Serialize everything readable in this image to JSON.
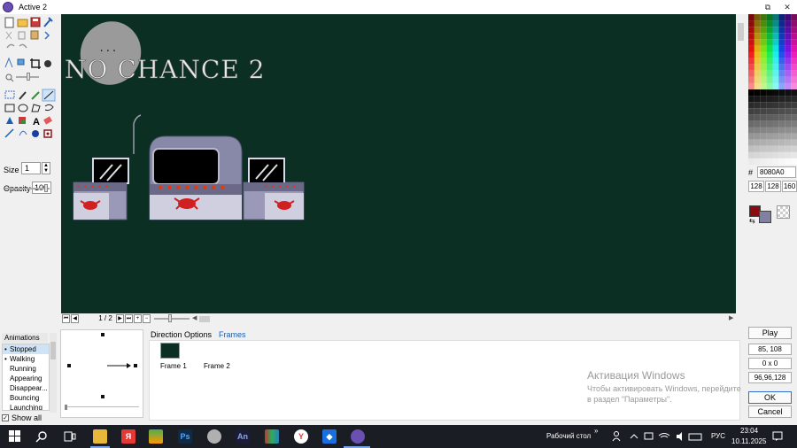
{
  "window": {
    "title": "Active 2",
    "buttons": [
      "⧉",
      "✕"
    ]
  },
  "toolbox": {
    "size_label": "Size",
    "size_value": "1",
    "opacity_label": "Opacity",
    "opacity_value": "100"
  },
  "canvas": {
    "background": "#0b2f22",
    "game_title": "NO CHANCE 2",
    "speech_dots": "..."
  },
  "framebar": {
    "counter": "1 / 2"
  },
  "color_panel": {
    "hash": "#",
    "hex": "8080A0",
    "r": "128",
    "g": "128",
    "b": "160",
    "fg_color": "#8a0a12",
    "bg_color": "#8080a0"
  },
  "animations": {
    "title": "Animations",
    "items": [
      "Stopped",
      "Walking",
      "Running",
      "Appearing",
      "Disappear...",
      "Bouncing",
      "Launching"
    ],
    "selected": "Stopped",
    "show_all_label": "Show all"
  },
  "tabs": {
    "direction": "Direction Options",
    "frames": "Frames"
  },
  "frames": [
    {
      "label": "Frame 1",
      "color": "#0b2f22"
    },
    {
      "label": "Frame 2",
      "color": "#ffffff"
    }
  ],
  "watermark": {
    "title": "Активация Windows",
    "body": "Чтобы активировать Windows, перейдите в раздел \"Параметры\"."
  },
  "right_buttons": {
    "play": "Play",
    "coords": "85, 108",
    "offset": "0 x 0",
    "rgb": "96,96,128",
    "ok": "OK",
    "cancel": "Cancel"
  },
  "taskbar": {
    "desktop_label": "Рабочий стол",
    "lang": "РУС",
    "time": "23:04",
    "date": "10.11.2025",
    "chevron": "»"
  }
}
